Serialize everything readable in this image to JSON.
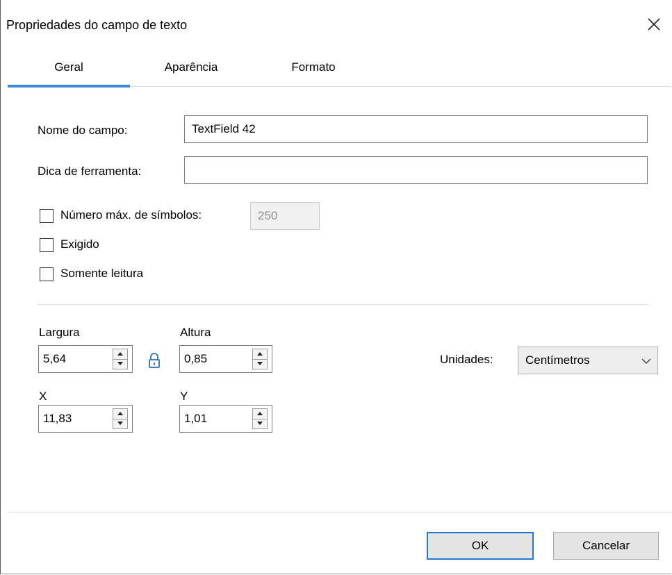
{
  "window": {
    "title": "Propriedades do campo de texto",
    "close_icon": "close-icon"
  },
  "tabs": [
    {
      "label": "Geral",
      "active": true
    },
    {
      "label": "Aparência",
      "active": false
    },
    {
      "label": "Formato",
      "active": false
    }
  ],
  "general": {
    "field_name_label": "Nome do campo:",
    "field_name_value": "TextField 42",
    "tooltip_label": "Dica de ferramenta:",
    "tooltip_value": "",
    "max_symbols_label": "Número máx. de símbolos:",
    "max_symbols_checked": false,
    "max_symbols_value": "250",
    "required_label": "Exigido",
    "required_checked": false,
    "readonly_label": "Somente leitura",
    "readonly_checked": false
  },
  "geometry": {
    "width_label": "Largura",
    "width_value": "5,64",
    "height_label": "Altura",
    "height_value": "0,85",
    "x_label": "X",
    "x_value": "11,83",
    "y_label": "Y",
    "y_value": "1,01",
    "lock_icon": "lock-icon",
    "units_label": "Unidades:",
    "units_value": "Centímetros"
  },
  "footer": {
    "ok_label": "OK",
    "cancel_label": "Cancelar"
  },
  "colors": {
    "accent": "#3c8ad8",
    "default_button_border": "#1f7ad4"
  }
}
